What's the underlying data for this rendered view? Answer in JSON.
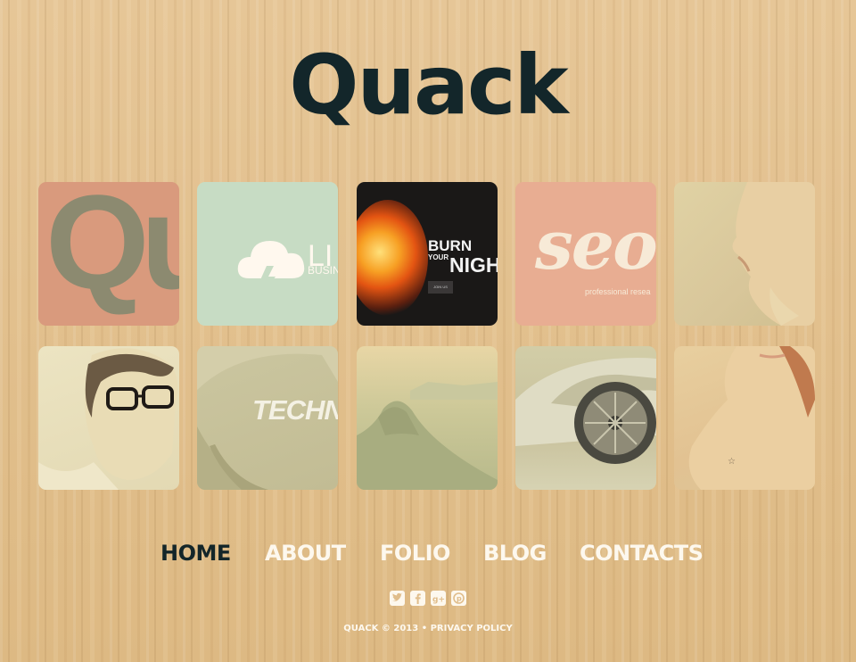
{
  "site": {
    "logo": "Quack"
  },
  "tiles": [
    {
      "name": "qu-tile",
      "text": "Qu"
    },
    {
      "name": "cloud-tile",
      "text": "LI",
      "subtext": "BUSIN"
    },
    {
      "name": "burn-night-tile",
      "line1": "BURN",
      "line2": "YOUR",
      "line3": "NIGHT",
      "button": "JOIN US"
    },
    {
      "name": "seo-tile",
      "text": "seo",
      "subtext": "professional resea"
    },
    {
      "name": "face-tile"
    },
    {
      "name": "man-glasses-tile"
    },
    {
      "name": "techno-tile",
      "text": "TECHNO"
    },
    {
      "name": "landscape-tile"
    },
    {
      "name": "car-tile"
    },
    {
      "name": "shoulder-tile"
    }
  ],
  "nav": {
    "items": [
      "HOME",
      "ABOUT",
      "FOLIO",
      "BLOG",
      "CONTACTS"
    ],
    "active": "HOME"
  },
  "social": {
    "icons": [
      "twitter-icon",
      "facebook-icon",
      "google-plus-icon",
      "pinterest-icon"
    ]
  },
  "footer": {
    "copyright": "QUACK © 2013 •",
    "privacy": "PRIVACY POLICY"
  },
  "colors": {
    "background": "#e2c08f",
    "logo": "#13262a",
    "nav_active": "#142629",
    "nav_text": "#fdf8ee"
  }
}
